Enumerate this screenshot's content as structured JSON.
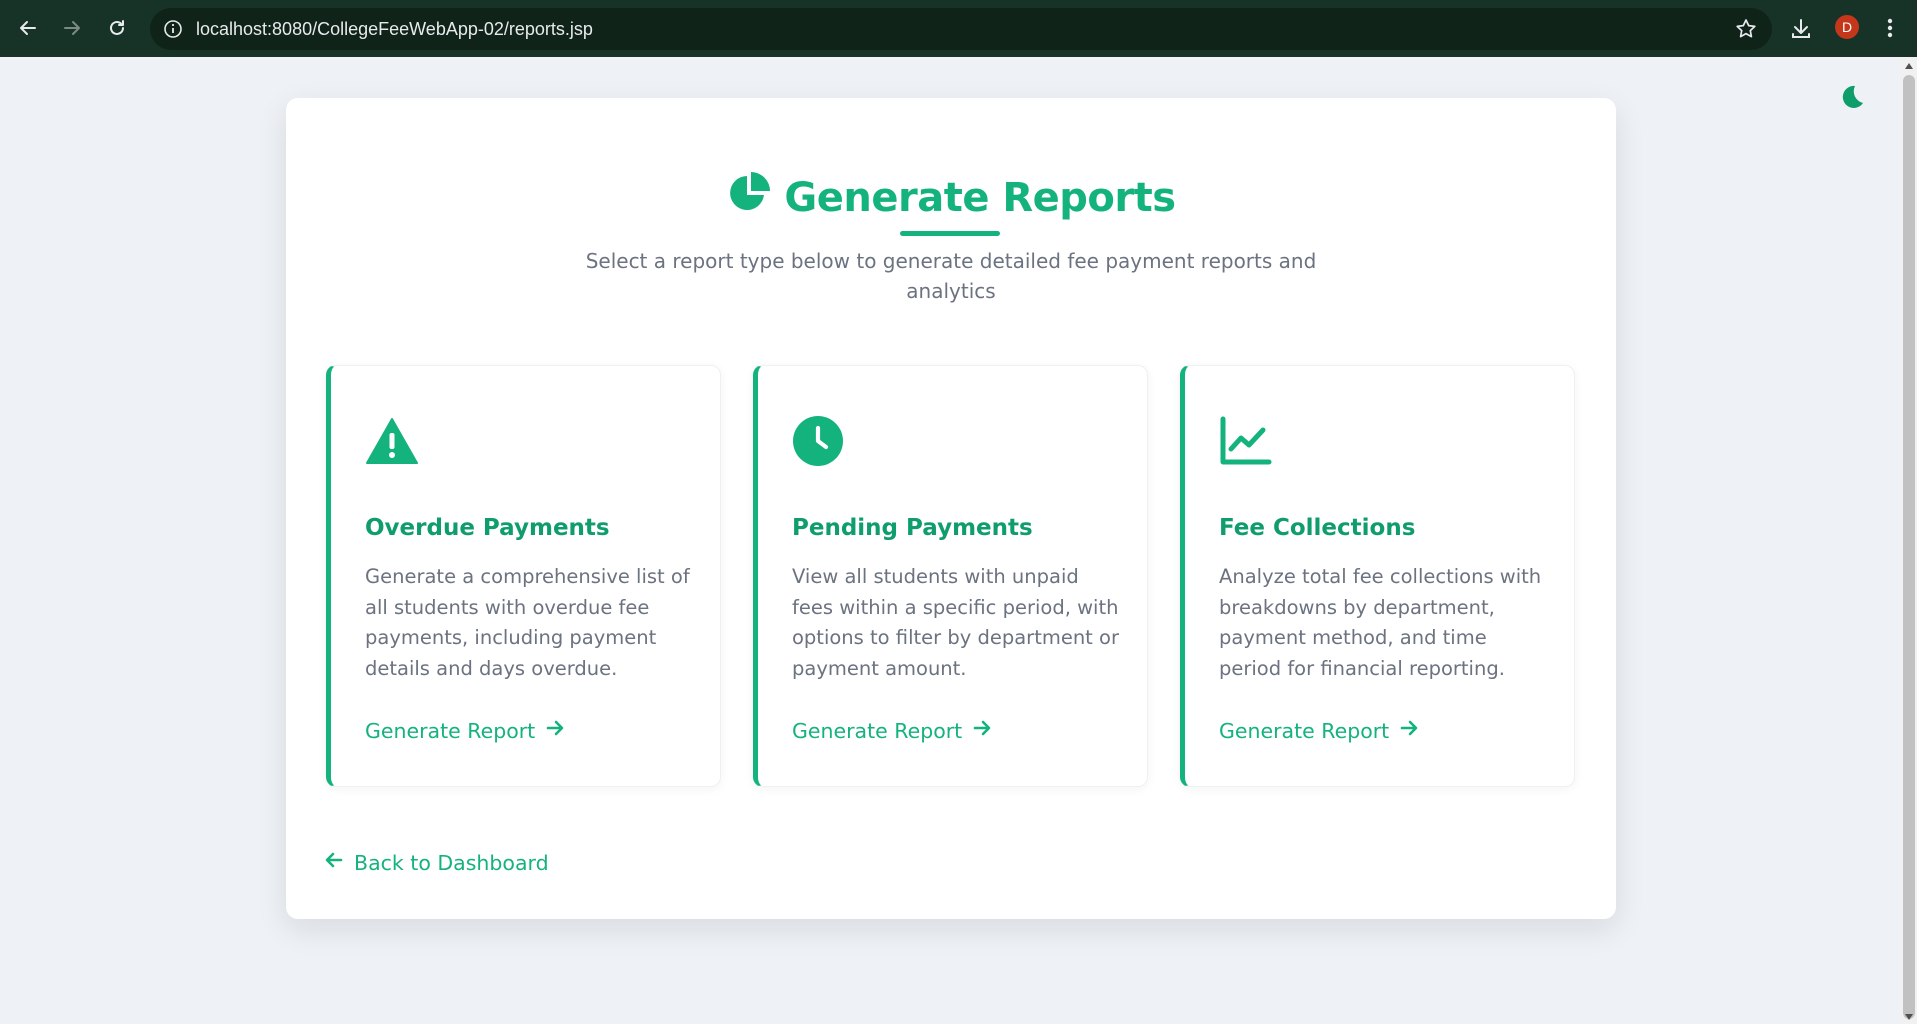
{
  "browser": {
    "url": "localhost:8080/CollegeFeeWebApp-02/reports.jsp",
    "avatar_letter": "D",
    "icons": [
      "back-arrow-icon",
      "forward-arrow-icon",
      "reload-icon",
      "info-icon",
      "star-icon",
      "download-icon",
      "kebab-menu-icon"
    ]
  },
  "theme": {
    "toggle_icon": "moon-icon",
    "accent": "#14b37d",
    "accent_dark": "#0f9d6c",
    "text_muted": "#6b7280"
  },
  "page": {
    "title": "Generate Reports",
    "title_icon": "pie-chart-icon",
    "subtitle": "Select a report type below to generate detailed fee payment reports and analytics"
  },
  "reports": [
    {
      "icon": "warning-triangle-icon",
      "title": "Overdue Payments",
      "description": "Generate a comprehensive list of all students with overdue fee payments, including payment details and days overdue.",
      "link": "Generate Report"
    },
    {
      "icon": "clock-icon",
      "title": "Pending Payments",
      "description": "View all students with unpaid fees within a specific period, with options to filter by department or payment amount.",
      "link": "Generate Report"
    },
    {
      "icon": "line-chart-icon",
      "title": "Fee Collections",
      "description": "Analyze total fee collections with breakdowns by department, payment method, and time period for financial reporting.",
      "link": "Generate Report"
    }
  ],
  "back_link": "Back to Dashboard"
}
